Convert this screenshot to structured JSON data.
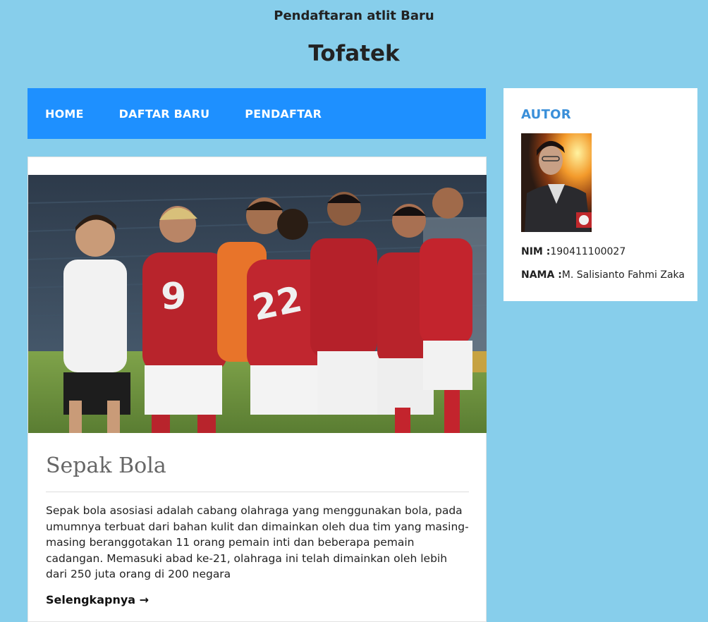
{
  "header": {
    "subtitle": "Pendaftaran atlit Baru",
    "title": "Tofatek"
  },
  "nav": {
    "items": [
      {
        "label": "HOME"
      },
      {
        "label": "DAFTAR BARU"
      },
      {
        "label": "PENDAFTAR"
      }
    ]
  },
  "post": {
    "title": "Sepak Bola",
    "excerpt": "Sepak bola asosiasi adalah cabang olahraga yang menggunakan bola, pada umumnya terbuat dari bahan kulit dan dimainkan oleh dua tim yang masing-masing beranggotakan 11 orang pemain inti dan beberapa pemain cadangan. Memasuki abad ke-21, olahraga ini telah dimainkan oleh lebih dari 250 juta orang di 200 negara",
    "read_more": "Selengkapnya →",
    "image_numbers": {
      "left": "9",
      "center": "22"
    }
  },
  "sidebar": {
    "widget_title": "AUTOR",
    "nim_label": "NIM :",
    "nim_value": "190411100027",
    "nama_label": "NAMA :",
    "nama_value": "M. Salisianto Fahmi Zaka"
  },
  "colors": {
    "page_bg": "#87ceeb",
    "nav_bg": "#1e90ff",
    "widget_title": "#3a8fd9"
  }
}
